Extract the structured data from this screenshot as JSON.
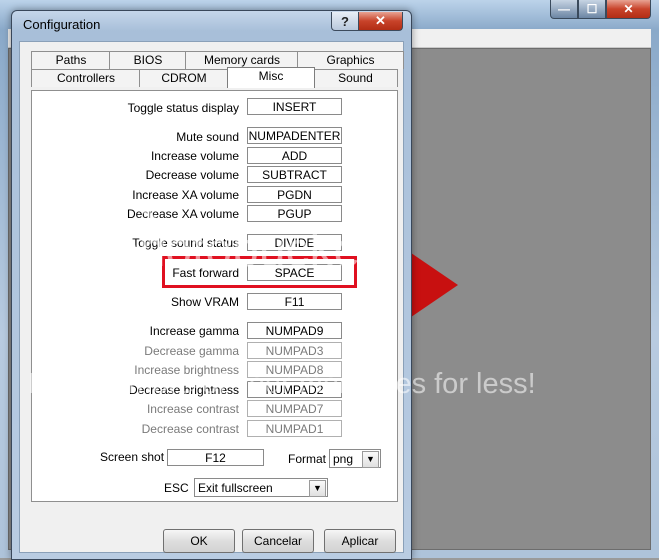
{
  "dialog": {
    "title": "Configuration",
    "help_glyph": "?",
    "close_glyph": "✕"
  },
  "bg_window": {
    "min_glyph": "—",
    "max_glyph": "☐",
    "close_glyph": "✕"
  },
  "tabs_row1": [
    "Paths",
    "BIOS",
    "Memory cards",
    "Graphics"
  ],
  "tabs_row2": [
    "Controllers",
    "CDROM",
    "Misc",
    "Sound"
  ],
  "selected_tab": "Misc",
  "keys": [
    {
      "label": "Toggle status display",
      "value": "INSERT"
    },
    {
      "label": "Mute sound",
      "value": "NUMPADENTER"
    },
    {
      "label": "Increase volume",
      "value": "ADD"
    },
    {
      "label": "Decrease volume",
      "value": "SUBTRACT"
    },
    {
      "label": "Increase XA volume",
      "value": "PGDN"
    },
    {
      "label": "Decrease XA volume",
      "value": "PGUP"
    },
    {
      "label": "Toggle sound status",
      "value": "DIVIDE"
    },
    {
      "label": "Fast forward",
      "value": "SPACE"
    },
    {
      "label": "Show VRAM",
      "value": "F11"
    },
    {
      "label": "Increase gamma",
      "value": "NUMPAD9"
    },
    {
      "label": "Decrease gamma",
      "value": "NUMPAD3"
    },
    {
      "label": "Increase brightness",
      "value": "NUMPAD8"
    },
    {
      "label": "Decrease brightness",
      "value": "NUMPAD2"
    },
    {
      "label": "Increase contrast",
      "value": "NUMPAD7"
    },
    {
      "label": "Decrease contrast",
      "value": "NUMPAD1"
    }
  ],
  "screenshot": {
    "label": "Screen shot",
    "value": "F12",
    "format_label": "Format",
    "format_value": "png"
  },
  "esc": {
    "label": "ESC",
    "value": "Exit fullscreen"
  },
  "buttons": {
    "ok": "OK",
    "cancel": "Cancelar",
    "apply": "Aplicar"
  },
  "watermark": {
    "line1": "photobucket",
    "line2": "Protect more of your memories for less!"
  },
  "colors": {
    "highlight": "#e01020",
    "arrow": "#c81010"
  }
}
